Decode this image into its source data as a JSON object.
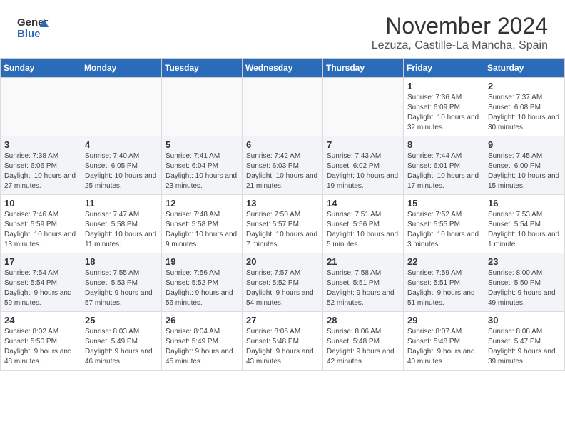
{
  "header": {
    "logo_general": "General",
    "logo_blue": "Blue",
    "month": "November 2024",
    "location": "Lezuza, Castille-La Mancha, Spain"
  },
  "days_of_week": [
    "Sunday",
    "Monday",
    "Tuesday",
    "Wednesday",
    "Thursday",
    "Friday",
    "Saturday"
  ],
  "weeks": [
    [
      {
        "day": "",
        "info": ""
      },
      {
        "day": "",
        "info": ""
      },
      {
        "day": "",
        "info": ""
      },
      {
        "day": "",
        "info": ""
      },
      {
        "day": "",
        "info": ""
      },
      {
        "day": "1",
        "info": "Sunrise: 7:36 AM\nSunset: 6:09 PM\nDaylight: 10 hours and 32 minutes."
      },
      {
        "day": "2",
        "info": "Sunrise: 7:37 AM\nSunset: 6:08 PM\nDaylight: 10 hours and 30 minutes."
      }
    ],
    [
      {
        "day": "3",
        "info": "Sunrise: 7:38 AM\nSunset: 6:06 PM\nDaylight: 10 hours and 27 minutes."
      },
      {
        "day": "4",
        "info": "Sunrise: 7:40 AM\nSunset: 6:05 PM\nDaylight: 10 hours and 25 minutes."
      },
      {
        "day": "5",
        "info": "Sunrise: 7:41 AM\nSunset: 6:04 PM\nDaylight: 10 hours and 23 minutes."
      },
      {
        "day": "6",
        "info": "Sunrise: 7:42 AM\nSunset: 6:03 PM\nDaylight: 10 hours and 21 minutes."
      },
      {
        "day": "7",
        "info": "Sunrise: 7:43 AM\nSunset: 6:02 PM\nDaylight: 10 hours and 19 minutes."
      },
      {
        "day": "8",
        "info": "Sunrise: 7:44 AM\nSunset: 6:01 PM\nDaylight: 10 hours and 17 minutes."
      },
      {
        "day": "9",
        "info": "Sunrise: 7:45 AM\nSunset: 6:00 PM\nDaylight: 10 hours and 15 minutes."
      }
    ],
    [
      {
        "day": "10",
        "info": "Sunrise: 7:46 AM\nSunset: 5:59 PM\nDaylight: 10 hours and 13 minutes."
      },
      {
        "day": "11",
        "info": "Sunrise: 7:47 AM\nSunset: 5:58 PM\nDaylight: 10 hours and 11 minutes."
      },
      {
        "day": "12",
        "info": "Sunrise: 7:48 AM\nSunset: 5:58 PM\nDaylight: 10 hours and 9 minutes."
      },
      {
        "day": "13",
        "info": "Sunrise: 7:50 AM\nSunset: 5:57 PM\nDaylight: 10 hours and 7 minutes."
      },
      {
        "day": "14",
        "info": "Sunrise: 7:51 AM\nSunset: 5:56 PM\nDaylight: 10 hours and 5 minutes."
      },
      {
        "day": "15",
        "info": "Sunrise: 7:52 AM\nSunset: 5:55 PM\nDaylight: 10 hours and 3 minutes."
      },
      {
        "day": "16",
        "info": "Sunrise: 7:53 AM\nSunset: 5:54 PM\nDaylight: 10 hours and 1 minute."
      }
    ],
    [
      {
        "day": "17",
        "info": "Sunrise: 7:54 AM\nSunset: 5:54 PM\nDaylight: 9 hours and 59 minutes."
      },
      {
        "day": "18",
        "info": "Sunrise: 7:55 AM\nSunset: 5:53 PM\nDaylight: 9 hours and 57 minutes."
      },
      {
        "day": "19",
        "info": "Sunrise: 7:56 AM\nSunset: 5:52 PM\nDaylight: 9 hours and 56 minutes."
      },
      {
        "day": "20",
        "info": "Sunrise: 7:57 AM\nSunset: 5:52 PM\nDaylight: 9 hours and 54 minutes."
      },
      {
        "day": "21",
        "info": "Sunrise: 7:58 AM\nSunset: 5:51 PM\nDaylight: 9 hours and 52 minutes."
      },
      {
        "day": "22",
        "info": "Sunrise: 7:59 AM\nSunset: 5:51 PM\nDaylight: 9 hours and 51 minutes."
      },
      {
        "day": "23",
        "info": "Sunrise: 8:00 AM\nSunset: 5:50 PM\nDaylight: 9 hours and 49 minutes."
      }
    ],
    [
      {
        "day": "24",
        "info": "Sunrise: 8:02 AM\nSunset: 5:50 PM\nDaylight: 9 hours and 48 minutes."
      },
      {
        "day": "25",
        "info": "Sunrise: 8:03 AM\nSunset: 5:49 PM\nDaylight: 9 hours and 46 minutes."
      },
      {
        "day": "26",
        "info": "Sunrise: 8:04 AM\nSunset: 5:49 PM\nDaylight: 9 hours and 45 minutes."
      },
      {
        "day": "27",
        "info": "Sunrise: 8:05 AM\nSunset: 5:48 PM\nDaylight: 9 hours and 43 minutes."
      },
      {
        "day": "28",
        "info": "Sunrise: 8:06 AM\nSunset: 5:48 PM\nDaylight: 9 hours and 42 minutes."
      },
      {
        "day": "29",
        "info": "Sunrise: 8:07 AM\nSunset: 5:48 PM\nDaylight: 9 hours and 40 minutes."
      },
      {
        "day": "30",
        "info": "Sunrise: 8:08 AM\nSunset: 5:47 PM\nDaylight: 9 hours and 39 minutes."
      }
    ]
  ]
}
